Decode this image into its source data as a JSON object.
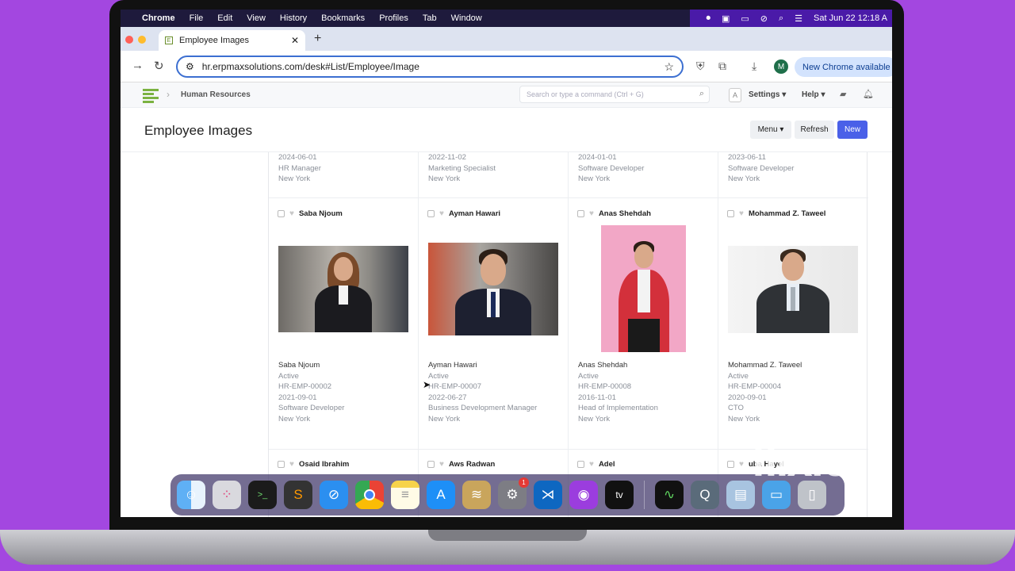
{
  "menubar": {
    "app": "Chrome",
    "items": [
      "File",
      "Edit",
      "View",
      "History",
      "Bookmarks",
      "Profiles",
      "Tab",
      "Window"
    ],
    "datetime": "Sat Jun 22  12:18 A"
  },
  "browser": {
    "tab_title": "Employee Images",
    "url": "hr.erpmaxsolutions.com/desk#List/Employee/Image",
    "avatar_letter": "M",
    "update_label": "New Chrome available"
  },
  "appnav": {
    "breadcrumb": "Human Resources",
    "search_placeholder": "Search or type a command (Ctrl + G)",
    "a_label": "A",
    "settings_label": "Settings",
    "help_label": "Help"
  },
  "page": {
    "title": "Employee Images",
    "menu_label": "Menu",
    "refresh_label": "Refresh",
    "new_label": "New"
  },
  "previous_row": [
    {
      "date": "2024-06-01",
      "designation": "HR Manager",
      "location": "New York"
    },
    {
      "date": "2022-11-02",
      "designation": "Marketing Specialist",
      "location": "New York"
    },
    {
      "date": "2024-01-01",
      "designation": "Software Developer",
      "location": "New York"
    },
    {
      "date": "2023-06-11",
      "designation": "Software Developer",
      "location": "New York"
    }
  ],
  "cards": [
    {
      "name": "Saba Njoum",
      "status": "Active",
      "id": "HR-EMP-00002",
      "date": "2021-09-01",
      "designation": "Software Developer",
      "location": "New York"
    },
    {
      "name": "Ayman Hawari",
      "status": "Active",
      "id": "HR-EMP-00007",
      "date": "2022-06-27",
      "designation": "Business Development Manager",
      "location": "New York"
    },
    {
      "name": "Anas Shehdah",
      "status": "Active",
      "id": "HR-EMP-00008",
      "date": "2016-11-01",
      "designation": "Head of Implementation",
      "location": "New York"
    },
    {
      "name": "Mohammad Z. Taweel",
      "status": "Active",
      "id": "HR-EMP-00004",
      "date": "2020-09-01",
      "designation": "CTO",
      "location": "New York"
    }
  ],
  "next_row": [
    "Osaid Ibrahim",
    "Aws Radwan",
    "Adel",
    "uba Hayel"
  ],
  "dock": {
    "apps": [
      "finder-icon",
      "launchpad-icon",
      "terminal-icon",
      "sublime-icon",
      "safari-icon",
      "chrome-icon",
      "notes-icon",
      "app-store-icon",
      "database-icon",
      "system-settings-icon",
      "vscode-icon",
      "podcasts-icon",
      "apple-tv-icon",
      "activity-monitor-icon",
      "quicktime-icon",
      "preview-icon",
      "folder-icon",
      "trash-icon"
    ],
    "settings_badge": "1",
    "tv_label": "tv"
  },
  "watermark": "flixie",
  "colors": {
    "accent": "#4a60e8",
    "background": "#a347e0",
    "logo": "#7bb241"
  }
}
